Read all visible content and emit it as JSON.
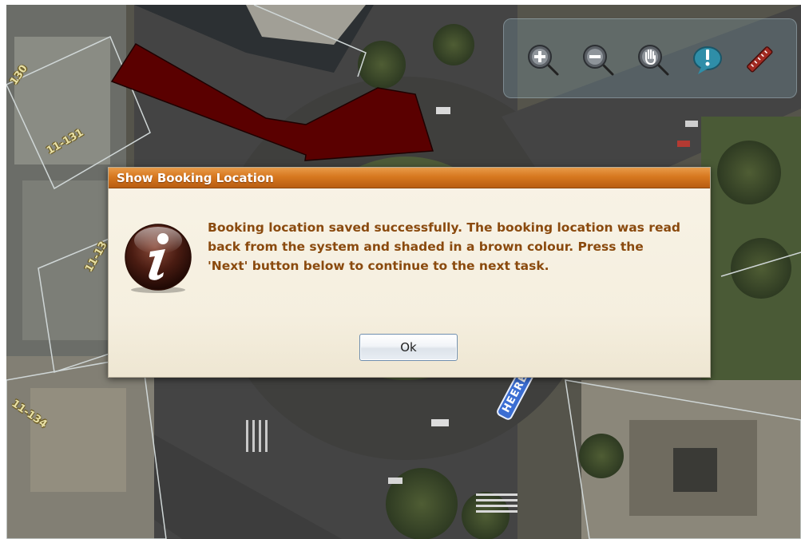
{
  "map": {
    "parcel_labels": [
      "130",
      "11-131",
      "11-13",
      "11-134"
    ],
    "street_label": "HEEREN",
    "toolbar": {
      "tools": [
        {
          "name": "zoom-in-icon",
          "label": "Zoom In"
        },
        {
          "name": "zoom-out-icon",
          "label": "Zoom Out"
        },
        {
          "name": "pan-icon",
          "label": "Pan"
        },
        {
          "name": "identify-icon",
          "label": "Identify"
        },
        {
          "name": "measure-icon",
          "label": "Measure"
        }
      ]
    },
    "colors": {
      "booking_shape": "#5a0000",
      "toolbar_bg": "#7896a0"
    }
  },
  "dialog": {
    "title": "Show Booking Location",
    "message": "Booking location saved successfully. The booking location was read back from the system and shaded in a brown colour. Press the 'Next' button below to continue to the next task.",
    "ok_label": "Ok",
    "icon": "info-icon",
    "colors": {
      "title_bar": "#d7781f",
      "message_text": "#8a4a0e",
      "body_bg": "#f5efdf"
    }
  }
}
